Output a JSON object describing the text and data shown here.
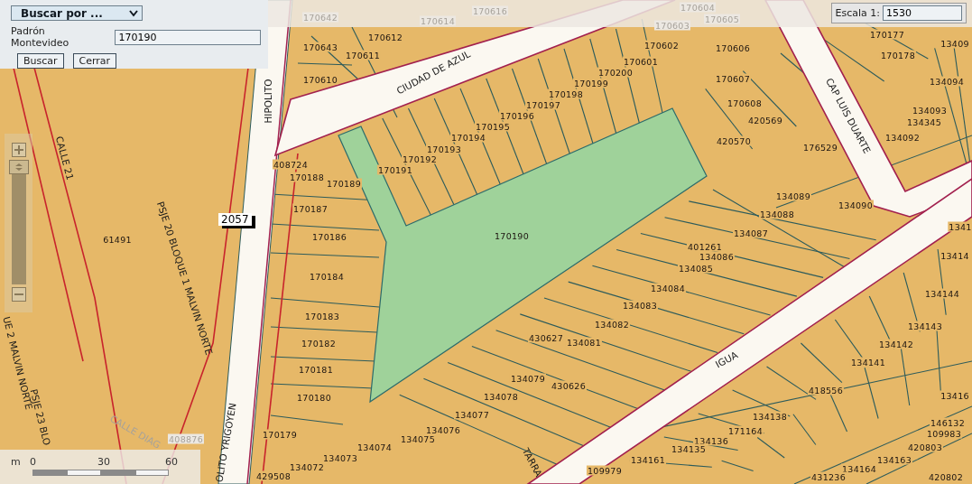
{
  "search_panel": {
    "mode_select": "Buscar por ...",
    "field_label": "Padrón Montevideo",
    "field_value": "170190",
    "buttons": [
      "Buscar",
      "Cerrar"
    ]
  },
  "scale": {
    "label": "Escala 1:",
    "value": "1530"
  },
  "scale_bar": {
    "unit": "m",
    "ticks": [
      "0",
      "30",
      "60"
    ]
  },
  "map": {
    "marker": "2057",
    "streets": [
      {
        "name": "CIUDAD DE AZUL",
        "faded": false
      },
      {
        "name": "HIPOLITO",
        "faded": false
      },
      {
        "name": "CAP LUIS DUARTE",
        "faded": false
      },
      {
        "name": "IGUA",
        "faded": false
      },
      {
        "name": "TARRA",
        "faded": false
      },
      {
        "name": "CALLE 21",
        "faded": false
      },
      {
        "name": "PSJE 20 BLOQUE 1 MALVIN NORTE",
        "faded": false
      },
      {
        "name": "UE 2 MALVIN NORTE",
        "faded": false
      },
      {
        "name": "PSJE 23 BLO",
        "faded": false
      },
      {
        "name": "OLITO YRIGOYEN",
        "faded": false
      },
      {
        "name": "CALLE DIAG",
        "faded": true
      }
    ],
    "parcels": [
      {
        "number": "170642",
        "faded": true
      },
      {
        "number": "170614",
        "faded": true
      },
      {
        "number": "170616",
        "faded": true
      },
      {
        "number": "170604",
        "faded": true
      },
      {
        "number": "170605",
        "faded": true
      },
      {
        "number": "170603",
        "faded": true
      },
      {
        "number": "170643",
        "faded": false
      },
      {
        "number": "170612",
        "faded": false
      },
      {
        "number": "170611",
        "faded": false
      },
      {
        "number": "170610",
        "faded": false
      },
      {
        "number": "170602",
        "faded": false
      },
      {
        "number": "170606",
        "faded": false
      },
      {
        "number": "170601",
        "faded": false
      },
      {
        "number": "170200",
        "faded": false
      },
      {
        "number": "170199",
        "faded": false
      },
      {
        "number": "170198",
        "faded": false
      },
      {
        "number": "170197",
        "faded": false
      },
      {
        "number": "170196",
        "faded": false
      },
      {
        "number": "170195",
        "faded": false
      },
      {
        "number": "170194",
        "faded": false
      },
      {
        "number": "170193",
        "faded": false
      },
      {
        "number": "170192",
        "faded": false
      },
      {
        "number": "170191",
        "faded": false
      },
      {
        "number": "408724",
        "faded": false
      },
      {
        "number": "170188",
        "faded": false
      },
      {
        "number": "170189",
        "faded": false
      },
      {
        "number": "170187",
        "faded": false
      },
      {
        "number": "170186",
        "faded": false
      },
      {
        "number": "170190",
        "faded": false
      },
      {
        "number": "170607",
        "faded": false
      },
      {
        "number": "170608",
        "faded": false
      },
      {
        "number": "420569",
        "faded": false
      },
      {
        "number": "420570",
        "faded": false
      },
      {
        "number": "176529",
        "faded": false
      },
      {
        "number": "170177",
        "faded": false
      },
      {
        "number": "170178",
        "faded": false
      },
      {
        "number": "13409",
        "faded": false
      },
      {
        "number": "134094",
        "faded": false
      },
      {
        "number": "134093",
        "faded": false
      },
      {
        "number": "134345",
        "faded": false
      },
      {
        "number": "134092",
        "faded": false
      },
      {
        "number": "134089",
        "faded": false
      },
      {
        "number": "134090",
        "faded": false
      },
      {
        "number": "134088",
        "faded": false
      },
      {
        "number": "134087",
        "faded": false
      },
      {
        "number": "1341",
        "faded": false
      },
      {
        "number": "401261",
        "faded": false
      },
      {
        "number": "134086",
        "faded": false
      },
      {
        "number": "134085",
        "faded": false
      },
      {
        "number": "134084",
        "faded": false
      },
      {
        "number": "134083",
        "faded": false
      },
      {
        "number": "134082",
        "faded": false
      },
      {
        "number": "134081",
        "faded": false
      },
      {
        "number": "430627",
        "faded": false
      },
      {
        "number": "134079",
        "faded": false
      },
      {
        "number": "430626",
        "faded": false
      },
      {
        "number": "134078",
        "faded": false
      },
      {
        "number": "134077",
        "faded": false
      },
      {
        "number": "134076",
        "faded": false
      },
      {
        "number": "134075",
        "faded": false
      },
      {
        "number": "134074",
        "faded": false
      },
      {
        "number": "134073",
        "faded": false
      },
      {
        "number": "134072",
        "faded": false
      },
      {
        "number": "170184",
        "faded": false
      },
      {
        "number": "170183",
        "faded": false
      },
      {
        "number": "170182",
        "faded": false
      },
      {
        "number": "170181",
        "faded": false
      },
      {
        "number": "170180",
        "faded": false
      },
      {
        "number": "170179",
        "faded": false
      },
      {
        "number": "429508",
        "faded": false
      },
      {
        "number": "61491",
        "faded": false
      },
      {
        "number": "13414",
        "faded": false
      },
      {
        "number": "134144",
        "faded": false
      },
      {
        "number": "134143",
        "faded": false
      },
      {
        "number": "134142",
        "faded": false
      },
      {
        "number": "134141",
        "faded": false
      },
      {
        "number": "418556",
        "faded": false
      },
      {
        "number": "134138",
        "faded": false
      },
      {
        "number": "171164",
        "faded": false
      },
      {
        "number": "134136",
        "faded": false
      },
      {
        "number": "134135",
        "faded": false
      },
      {
        "number": "13416",
        "faded": false
      },
      {
        "number": "146132",
        "faded": false
      },
      {
        "number": "109983",
        "faded": false
      },
      {
        "number": "420803",
        "faded": false
      },
      {
        "number": "134163",
        "faded": false
      },
      {
        "number": "134164",
        "faded": false
      },
      {
        "number": "431236",
        "faded": false
      },
      {
        "number": "420802",
        "faded": false
      },
      {
        "number": "134161",
        "faded": false
      },
      {
        "number": "109979",
        "faded": false
      },
      {
        "number": "408876",
        "faded": true
      }
    ]
  }
}
